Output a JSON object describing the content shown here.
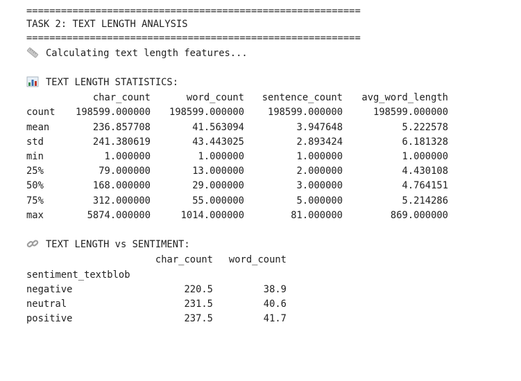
{
  "separator": "==========================================================",
  "task_title": "TASK 2: TEXT LENGTH ANALYSIS",
  "calc_message": "Calculating text length features...",
  "stats_heading": "TEXT LENGTH STATISTICS:",
  "stats_table": {
    "columns": [
      "char_count",
      "word_count",
      "sentence_count",
      "avg_word_length"
    ],
    "rows": [
      {
        "index": "count",
        "values": [
          "198599.000000",
          "198599.000000",
          "198599.000000",
          "198599.000000"
        ]
      },
      {
        "index": "mean",
        "values": [
          "236.857708",
          "41.563094",
          "3.947648",
          "5.222578"
        ]
      },
      {
        "index": "std",
        "values": [
          "241.380619",
          "43.443025",
          "2.893424",
          "6.181328"
        ]
      },
      {
        "index": "min",
        "values": [
          "1.000000",
          "1.000000",
          "1.000000",
          "1.000000"
        ]
      },
      {
        "index": "25%",
        "values": [
          "79.000000",
          "13.000000",
          "2.000000",
          "4.430108"
        ]
      },
      {
        "index": "50%",
        "values": [
          "168.000000",
          "29.000000",
          "3.000000",
          "4.764151"
        ]
      },
      {
        "index": "75%",
        "values": [
          "312.000000",
          "55.000000",
          "5.000000",
          "5.214286"
        ]
      },
      {
        "index": "max",
        "values": [
          "5874.000000",
          "1014.000000",
          "81.000000",
          "869.000000"
        ]
      }
    ]
  },
  "sentiment_heading": "TEXT LENGTH vs SENTIMENT:",
  "sentiment_table": {
    "columns": [
      "char_count",
      "word_count"
    ],
    "index_name": "sentiment_textblob",
    "rows": [
      {
        "index": "negative",
        "values": [
          "220.5",
          "38.9"
        ]
      },
      {
        "index": "neutral",
        "values": [
          "231.5",
          "40.6"
        ]
      },
      {
        "index": "positive",
        "values": [
          "237.5",
          "41.7"
        ]
      }
    ]
  },
  "icons": {
    "calc": "ruler-icon",
    "stats": "bar-chart-icon",
    "sentiment": "link-icon"
  }
}
